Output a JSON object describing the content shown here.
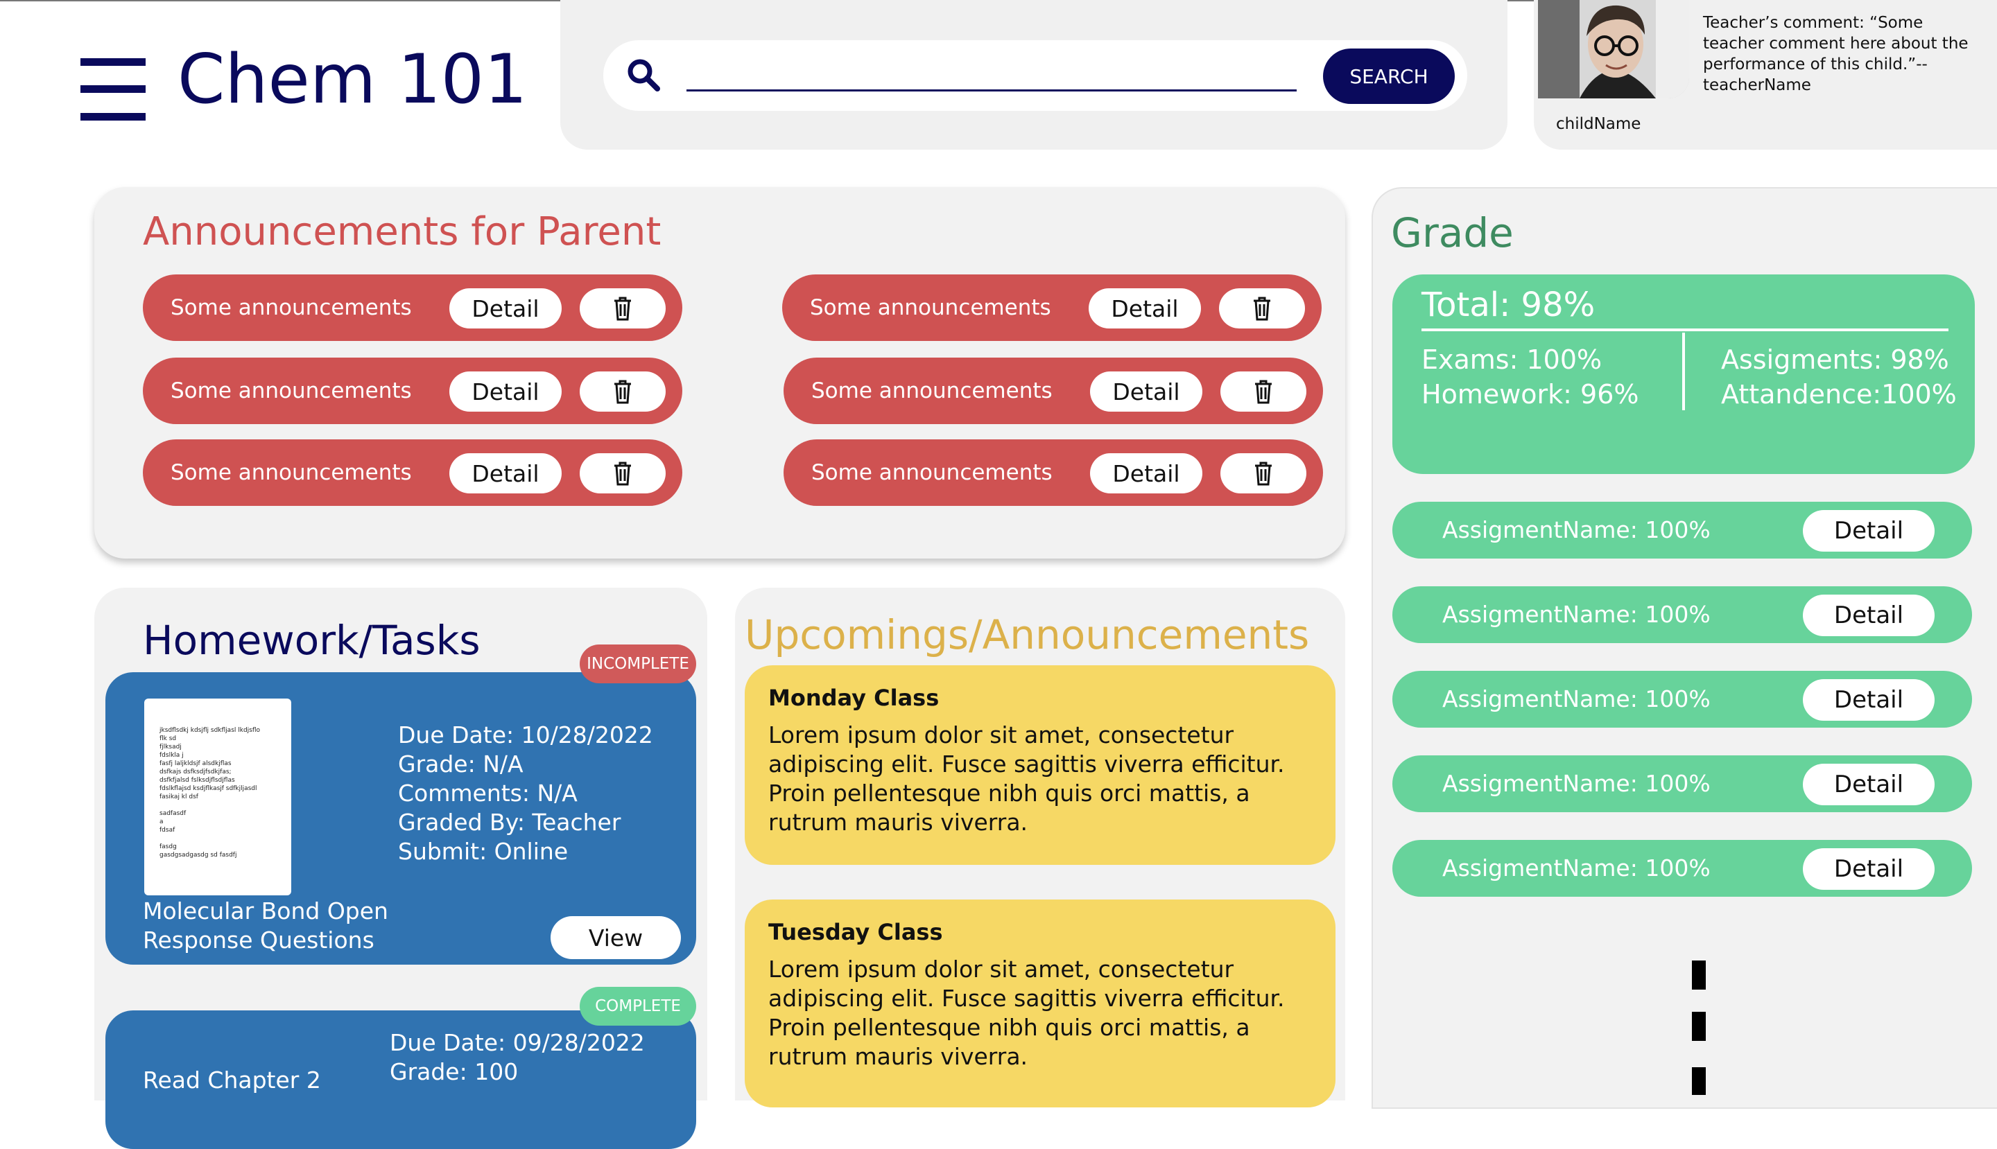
{
  "header": {
    "title": "Chem 101",
    "search_button": "SEARCH",
    "search_placeholder": "",
    "teacher_comment": "Teacher’s comment: “Some teacher comment here about the performance of this child.”--teacherName",
    "child_name": "childName"
  },
  "announcements": {
    "title": "Announcements for Parent",
    "items": [
      {
        "text": "Some announcements",
        "detail_label": "Detail"
      },
      {
        "text": "Some announcements",
        "detail_label": "Detail"
      },
      {
        "text": "Some announcements",
        "detail_label": "Detail"
      },
      {
        "text": "Some announcements",
        "detail_label": "Detail"
      },
      {
        "text": "Some announcements",
        "detail_label": "Detail"
      },
      {
        "text": "Some announcements",
        "detail_label": "Detail"
      }
    ]
  },
  "homework": {
    "title": "Homework/Tasks",
    "tasks": [
      {
        "status": "INCOMPLETE",
        "thumbnail_lines": [
          "jksdflsdkj kdsjflj sdkfljasl lkdjsflo",
          "flk sd",
          "fjlksadj",
          "fdslkla j",
          "fasfj laljkldsjf alsdkjflas",
          "dsfkajs dsfksdjfsdkjfas;",
          "dsfkfjalsd fslksdjflsdjflas",
          "fdslkflajsd ksdjflkasjf sdfkjljasdl",
          "fasikaj kl dsf",
          "",
          "sadfasdf",
          "a",
          "fdsaf",
          "",
          "fasdg",
          "gasdgsadgasdg sd fasdfj"
        ],
        "due_date": "Due Date: 10/28/2022",
        "grade": "Grade: N/A",
        "comments": "Comments: N/A",
        "graded_by": "Graded By: Teacher",
        "submit": "Submit: Online",
        "name": "Molecular Bond Open Response Questions",
        "view_label": "View"
      },
      {
        "status": "COMPLETE",
        "due_date": "Due Date: 09/28/2022",
        "grade": "Grade: 100",
        "name": "Read Chapter 2"
      }
    ]
  },
  "upcoming": {
    "title": "Upcomings/Announcements",
    "items": [
      {
        "title": "Monday Class",
        "body": "Lorem ipsum dolor sit amet, consectetur adipiscing elit. Fusce sagittis viverra efficitur. Proin pellentesque nibh quis orci mattis, a rutrum mauris viverra."
      },
      {
        "title": "Tuesday Class",
        "body": "Lorem ipsum dolor sit amet, consectetur adipiscing elit. Fusce sagittis viverra efficitur. Proin pellentesque nibh quis orci mattis, a rutrum mauris viverra."
      }
    ]
  },
  "grade": {
    "title": "Grade",
    "total": "Total: 98%",
    "exams": "Exams: 100%",
    "homework": "Homework: 96%",
    "assignments": "Assigments: 98%",
    "attendance": "Attandence:100%",
    "assignment_items": [
      {
        "text": "AssigmentName: 100%",
        "detail_label": "Detail"
      },
      {
        "text": "AssigmentName: 100%",
        "detail_label": "Detail"
      },
      {
        "text": "AssigmentName: 100%",
        "detail_label": "Detail"
      },
      {
        "text": "AssigmentName: 100%",
        "detail_label": "Detail"
      },
      {
        "text": "AssigmentName: 100%",
        "detail_label": "Detail"
      }
    ]
  },
  "colors": {
    "navy": "#0a0a5c",
    "announcement_red": "#cf5252",
    "grade_green": "#67d39b",
    "task_blue": "#3073b1",
    "upcoming_yellow": "#f6d865"
  },
  "icons": {
    "menu": "hamburger-menu-icon",
    "search": "magnifier-icon",
    "delete": "trash-icon"
  }
}
